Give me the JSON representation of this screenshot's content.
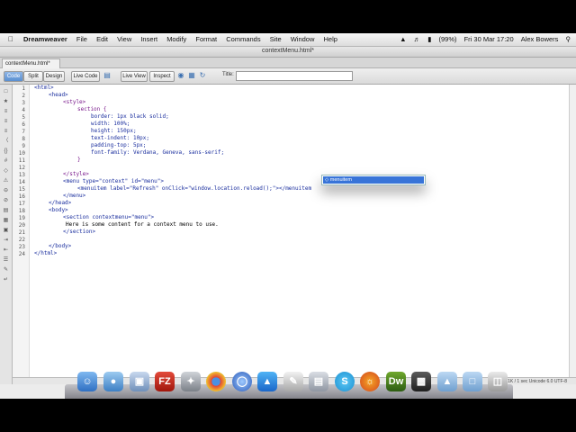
{
  "menubar": {
    "apple": "",
    "app": "Dreamweaver",
    "menus": [
      "File",
      "Edit",
      "View",
      "Insert",
      "Modify",
      "Format",
      "Commands",
      "Site",
      "Window",
      "Help"
    ],
    "battery": "(99%)",
    "datetime": "Fri 30 Mar  17:20",
    "user": "Alex Bowers"
  },
  "window": {
    "title": "contextMenu.html*"
  },
  "tab": {
    "label": "contextMenu.html*"
  },
  "toolbar": {
    "code": "Code",
    "split": "Split",
    "design": "Design",
    "live_code": "Live Code",
    "live_view": "Live View",
    "inspect": "Inspect",
    "title_label": "Title:",
    "title_value": ""
  },
  "code": {
    "line_numbers": [
      "1",
      "2",
      "3",
      "4",
      "5",
      "6",
      "7",
      "8",
      "9",
      "10",
      "11",
      "12",
      "13",
      "14",
      "15",
      "16",
      "17",
      "18",
      "19",
      "20",
      "21",
      "22",
      "23",
      "24"
    ],
    "lines": {
      "l1": "<html>",
      "l2": "<head>",
      "l3": "<style>",
      "l4": "section {",
      "l5": "border: 1px black solid;",
      "l6": "width: 100%;",
      "l7": "height: 150px;",
      "l8": "text-indent: 10px;",
      "l9": "padding-top: 5px;",
      "l10": "font-family: Verdana, Geneva, sans-serif;",
      "l11": "}",
      "l12": "",
      "l13": "</style>",
      "l14": "<menu type=\"context\" id=\"menu\">",
      "l15": "<menuitem label=\"Refresh\" onClick=\"window.location.reload();\"></menuitem",
      "l16": "</menu>",
      "l17": "</head>",
      "l18": "<body>",
      "l19": "<section contextmenu=\"menu\">",
      "l20": "Here is some content for a context menu to use.",
      "l21": "</section>",
      "l22": "",
      "l23": "</body>",
      "l24": "</html>"
    }
  },
  "autocomplete": {
    "item": "menuitem"
  },
  "statusbar": {
    "text": "1K / 1 sec  Unicode 6.0 UTF-8"
  },
  "dock": {
    "fz_label": "FZ",
    "dw_label": "Dw",
    "s_label": "S"
  }
}
